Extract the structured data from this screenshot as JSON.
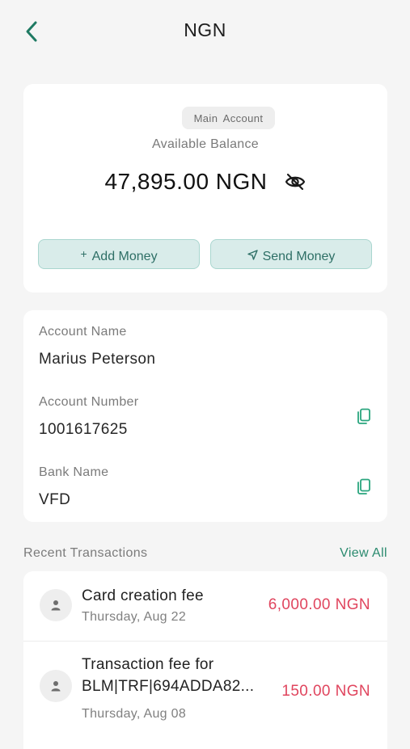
{
  "header": {
    "title": "NGN",
    "back_icon": "chevron-left-icon"
  },
  "colors": {
    "accent": "#2a8a6e",
    "debit": "#e0455e",
    "button_bg": "#d9ecea",
    "background": "#f5f5f5"
  },
  "balance": {
    "badge": "Main Account",
    "label": "Available Balance",
    "amount": "47,895.00 NGN",
    "visibility_icon": "eye-off-icon",
    "add_money": {
      "icon": "+",
      "label": "Add Money"
    },
    "send_money": {
      "icon": "send-icon",
      "label": "Send Money"
    }
  },
  "account": {
    "name_label": "Account Name",
    "name_value": "Marius Peterson",
    "number_label": "Account Number",
    "number_value": "1001617625",
    "bank_label": "Bank Name",
    "bank_value": "VFD",
    "copy_icon": "copy-icon"
  },
  "transactions": {
    "section_title": "Recent Transactions",
    "view_all": "View All",
    "items": [
      {
        "title": "Card creation fee",
        "date": "Thursday, Aug 22",
        "amount": "6,000.00 NGN"
      },
      {
        "title_line1": "Transaction fee for",
        "title_line2": "BLM|TRF|694ADDA82...",
        "date": "Thursday, Aug 08",
        "amount": "150.00 NGN"
      }
    ]
  }
}
